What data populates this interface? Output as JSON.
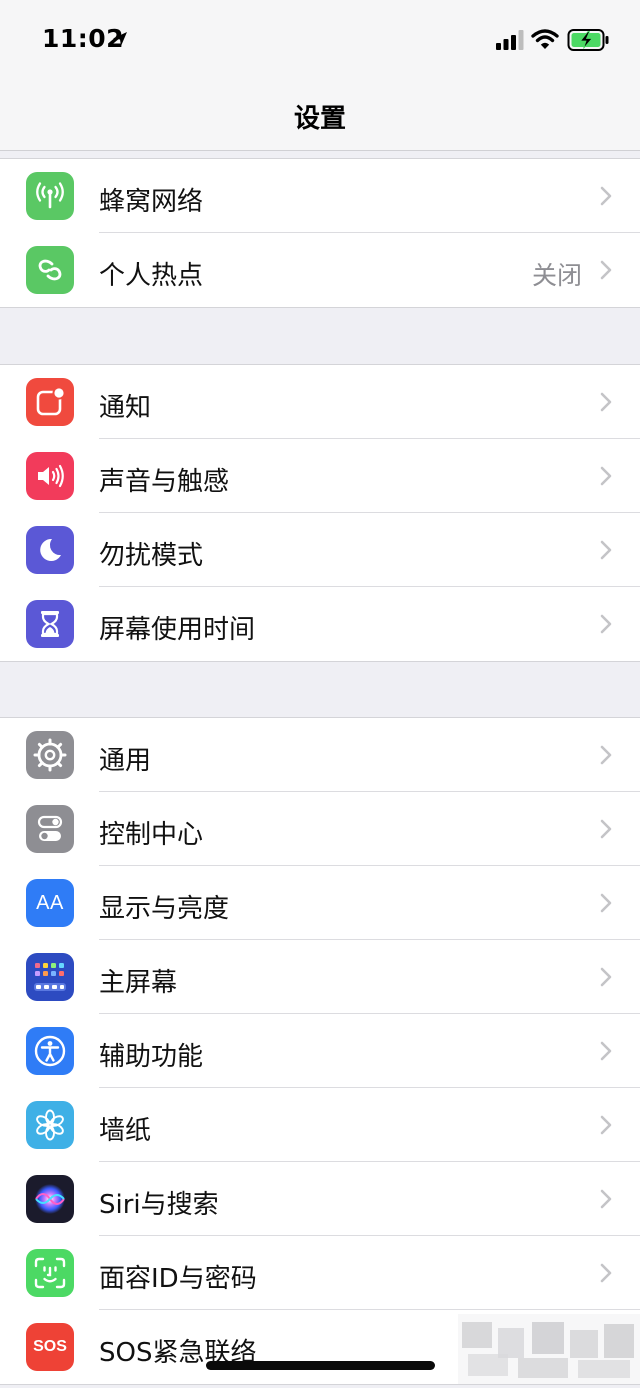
{
  "status": {
    "time": "11:02"
  },
  "nav": {
    "title": "设置"
  },
  "colors": {
    "green": "#5ac864",
    "red": "#f04a3e",
    "pink": "#f23b5b",
    "indigo": "#5b58d6",
    "gray": "#8e8e93",
    "blue": "#2f7cf6",
    "navy": "#2d4bc1",
    "teal": "#3fb0e6",
    "siri": "#1b1b2c",
    "faceid": "#4cd964",
    "sos": "#ee4236"
  },
  "groups": [
    {
      "items": [
        {
          "key": "cellular",
          "label": "蜂窝网络",
          "icon": "antenna-icon",
          "color": "green"
        },
        {
          "key": "hotspot",
          "label": "个人热点",
          "value": "关闭",
          "icon": "link-icon",
          "color": "green"
        }
      ]
    },
    {
      "items": [
        {
          "key": "notifications",
          "label": "通知",
          "icon": "notification-icon",
          "color": "red"
        },
        {
          "key": "sounds",
          "label": "声音与触感",
          "icon": "speaker-icon",
          "color": "pink"
        },
        {
          "key": "dnd",
          "label": "勿扰模式",
          "icon": "moon-icon",
          "color": "indigo"
        },
        {
          "key": "screentime",
          "label": "屏幕使用时间",
          "icon": "hourglass-icon",
          "color": "indigo"
        }
      ]
    },
    {
      "items": [
        {
          "key": "general",
          "label": "通用",
          "icon": "gear-icon",
          "color": "gray"
        },
        {
          "key": "control",
          "label": "控制中心",
          "icon": "toggles-icon",
          "color": "gray"
        },
        {
          "key": "display",
          "label": "显示与亮度",
          "icon": "text-size-icon",
          "icon_text": "AA",
          "color": "blue"
        },
        {
          "key": "homescreen",
          "label": "主屏幕",
          "icon": "app-grid-icon",
          "color": "navy"
        },
        {
          "key": "accessibility",
          "label": "辅助功能",
          "icon": "accessibility-icon",
          "color": "blue"
        },
        {
          "key": "wallpaper",
          "label": "墙纸",
          "icon": "flower-icon",
          "color": "teal"
        },
        {
          "key": "siri",
          "label": "Siri与搜索",
          "icon": "siri-icon",
          "color": "siri"
        },
        {
          "key": "faceid",
          "label": "面容ID与密码",
          "icon": "face-id-icon",
          "color": "faceid"
        },
        {
          "key": "sos",
          "label": "SOS紧急联络",
          "icon": "sos-icon",
          "icon_text": "SOS",
          "color": "sos"
        }
      ]
    }
  ]
}
